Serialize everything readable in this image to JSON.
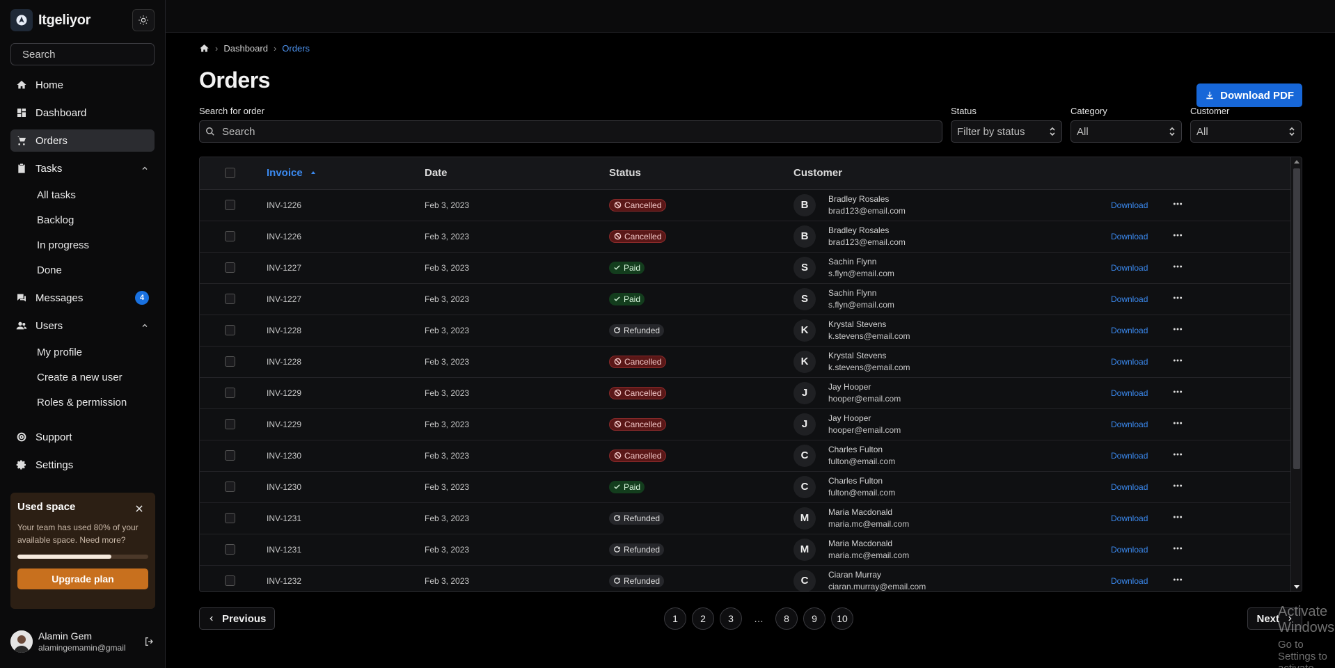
{
  "app": {
    "name": "Itgeliyor"
  },
  "sidebar": {
    "search_placeholder": "Search",
    "items": [
      {
        "label": "Home",
        "icon": "home-icon"
      },
      {
        "label": "Dashboard",
        "icon": "dashboard-icon"
      },
      {
        "label": "Orders",
        "icon": "cart-icon",
        "active": true
      },
      {
        "label": "Tasks",
        "icon": "clipboard-icon",
        "expanded": true,
        "children": [
          "All tasks",
          "Backlog",
          "In progress",
          "Done"
        ]
      },
      {
        "label": "Messages",
        "icon": "chat-icon",
        "badge": "4"
      },
      {
        "label": "Users",
        "icon": "users-icon",
        "expanded": true,
        "children": [
          "My profile",
          "Create a new user",
          "Roles & permission"
        ]
      },
      {
        "label": "Support",
        "icon": "lifebuoy-icon"
      },
      {
        "label": "Settings",
        "icon": "gear-icon"
      }
    ],
    "used_space": {
      "title": "Used space",
      "text": "Your team has used 80% of your available space. Need more?",
      "progress": 0.8,
      "button": "Upgrade plan"
    },
    "user": {
      "name": "Alamin Gem",
      "email": "alamingemamin@gmail"
    }
  },
  "breadcrumb": {
    "items": [
      "Dashboard",
      "Orders"
    ]
  },
  "page": {
    "title": "Orders",
    "download_pdf": "Download PDF"
  },
  "filters": {
    "search_label": "Search for order",
    "search_placeholder": "Search",
    "status_label": "Status",
    "status_value": "Filter by status",
    "category_label": "Category",
    "category_value": "All",
    "customer_label": "Customer",
    "customer_value": "All"
  },
  "table": {
    "columns": [
      "Invoice",
      "Date",
      "Status",
      "Customer"
    ],
    "download_label": "Download",
    "rows": [
      {
        "invoice": "INV-1226",
        "date": "Feb 3, 2023",
        "status": "Cancelled",
        "initial": "B",
        "name": "Bradley Rosales",
        "email": "brad123@email.com"
      },
      {
        "invoice": "INV-1226",
        "date": "Feb 3, 2023",
        "status": "Cancelled",
        "initial": "B",
        "name": "Bradley Rosales",
        "email": "brad123@email.com"
      },
      {
        "invoice": "INV-1227",
        "date": "Feb 3, 2023",
        "status": "Paid",
        "initial": "S",
        "name": "Sachin Flynn",
        "email": "s.flyn@email.com"
      },
      {
        "invoice": "INV-1227",
        "date": "Feb 3, 2023",
        "status": "Paid",
        "initial": "S",
        "name": "Sachin Flynn",
        "email": "s.flyn@email.com"
      },
      {
        "invoice": "INV-1228",
        "date": "Feb 3, 2023",
        "status": "Refunded",
        "initial": "K",
        "name": "Krystal Stevens",
        "email": "k.stevens@email.com"
      },
      {
        "invoice": "INV-1228",
        "date": "Feb 3, 2023",
        "status": "Cancelled",
        "initial": "K",
        "name": "Krystal Stevens",
        "email": "k.stevens@email.com"
      },
      {
        "invoice": "INV-1229",
        "date": "Feb 3, 2023",
        "status": "Cancelled",
        "initial": "J",
        "name": "Jay Hooper",
        "email": "hooper@email.com"
      },
      {
        "invoice": "INV-1229",
        "date": "Feb 3, 2023",
        "status": "Cancelled",
        "initial": "J",
        "name": "Jay Hooper",
        "email": "hooper@email.com"
      },
      {
        "invoice": "INV-1230",
        "date": "Feb 3, 2023",
        "status": "Cancelled",
        "initial": "C",
        "name": "Charles Fulton",
        "email": "fulton@email.com"
      },
      {
        "invoice": "INV-1230",
        "date": "Feb 3, 2023",
        "status": "Paid",
        "initial": "C",
        "name": "Charles Fulton",
        "email": "fulton@email.com"
      },
      {
        "invoice": "INV-1231",
        "date": "Feb 3, 2023",
        "status": "Refunded",
        "initial": "M",
        "name": "Maria Macdonald",
        "email": "maria.mc@email.com"
      },
      {
        "invoice": "INV-1231",
        "date": "Feb 3, 2023",
        "status": "Refunded",
        "initial": "M",
        "name": "Maria Macdonald",
        "email": "maria.mc@email.com"
      },
      {
        "invoice": "INV-1232",
        "date": "Feb 3, 2023",
        "status": "Refunded",
        "initial": "C",
        "name": "Ciaran Murray",
        "email": "ciaran.murray@email.com"
      }
    ]
  },
  "pagination": {
    "previous": "Previous",
    "next": "Next",
    "pages_left": [
      "1",
      "2",
      "3"
    ],
    "ellipsis": "…",
    "pages_right": [
      "8",
      "9",
      "10"
    ]
  },
  "watermark": {
    "line1": "Activate Windows",
    "line2": "Go to Settings to activate Windows."
  },
  "colors": {
    "accent": "#1767d8",
    "link": "#3b8af0",
    "cancelled": "#5a1717",
    "paid": "#133d1d",
    "upgrade": "#c8701e"
  }
}
